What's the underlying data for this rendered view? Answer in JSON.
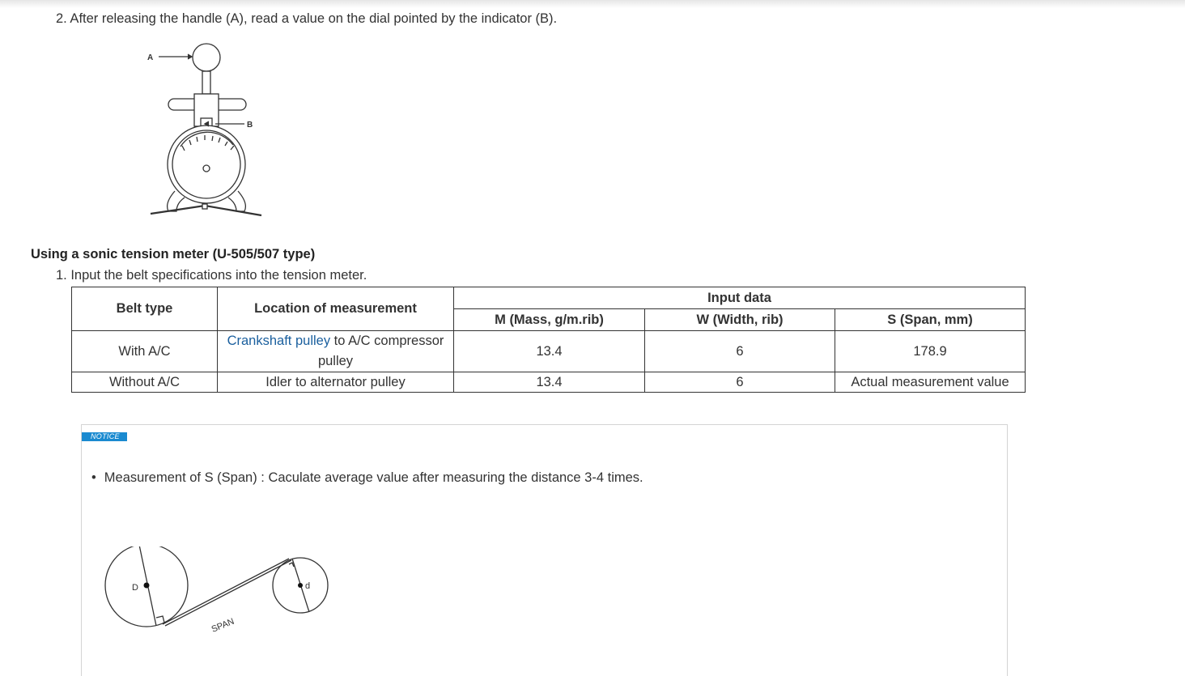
{
  "step2": "2. After releasing the handle (A), read a value on the dial pointed by the indicator (B).",
  "meter_figure": {
    "label_a": "A",
    "label_b": "B"
  },
  "section_title": "Using a sonic tension meter (U-505/507 type)",
  "step1": "1. Input the belt specifications into the tension meter.",
  "table": {
    "headers": {
      "belt_type": "Belt type",
      "location": "Location of measurement",
      "input_data": "Input data",
      "mass": "M (Mass, g/m.rib)",
      "width": "W (Width, rib)",
      "span": "S (Span, mm)"
    },
    "rows": [
      {
        "belt_type": "With A/C",
        "location_link": "Crankshaft pulley",
        "location_rest": " to A/C compressor pulley",
        "mass": "13.4",
        "width": "6",
        "span": "178.9"
      },
      {
        "belt_type": "Without A/C",
        "location_link": "",
        "location_rest": "Idler to alternator pulley",
        "mass": "13.4",
        "width": "6",
        "span": "Actual measurement value"
      }
    ]
  },
  "notice": {
    "badge": "NOTICE",
    "bullet": "Measurement of S (Span) : Caculate average value after measuring the distance 3-4 times.",
    "figure": {
      "label_big": "D",
      "label_small": "d",
      "label_span": "SPAN"
    }
  }
}
